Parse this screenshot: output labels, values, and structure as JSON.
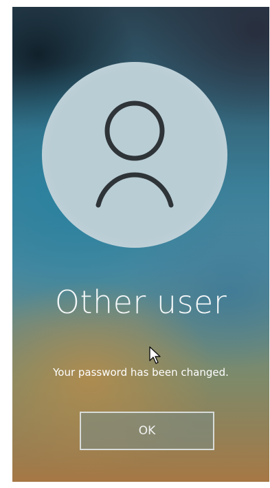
{
  "login": {
    "username": "Other user",
    "message": "Your password has been changed.",
    "ok_label": "OK"
  },
  "icons": {
    "avatar": "user-silhouette-icon",
    "cursor": "mouse-pointer-icon"
  },
  "colors": {
    "avatar_bg": "#b9cdd5",
    "avatar_stroke": "#2e3438",
    "text": "#ffffff"
  }
}
